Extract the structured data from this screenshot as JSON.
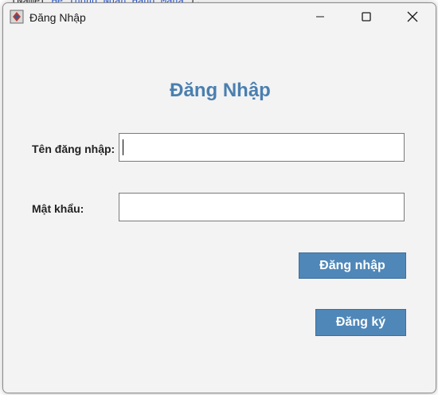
{
  "background_code": {
    "top_line_prefix": "(Name(",
    "top_line_string": "\"He Thong Ngan Hang Mana\"",
    "top_line_suffix": ");"
  },
  "window": {
    "title": "Đăng Nhập",
    "controls": {
      "minimize": "minimize-icon",
      "maximize": "maximize-icon",
      "close": "close-icon"
    }
  },
  "form": {
    "heading": "Đăng Nhập",
    "username_label": "Tên đăng nhập:",
    "username_value": "",
    "password_label": "Mật khẩu:",
    "password_value": "",
    "login_button": "Đăng nhập",
    "register_button": "Đăng ký"
  },
  "colors": {
    "heading": "#4a7fb0",
    "button_bg": "#4f87b8",
    "button_text": "#ffffff",
    "window_bg": "#f3f3f3"
  }
}
